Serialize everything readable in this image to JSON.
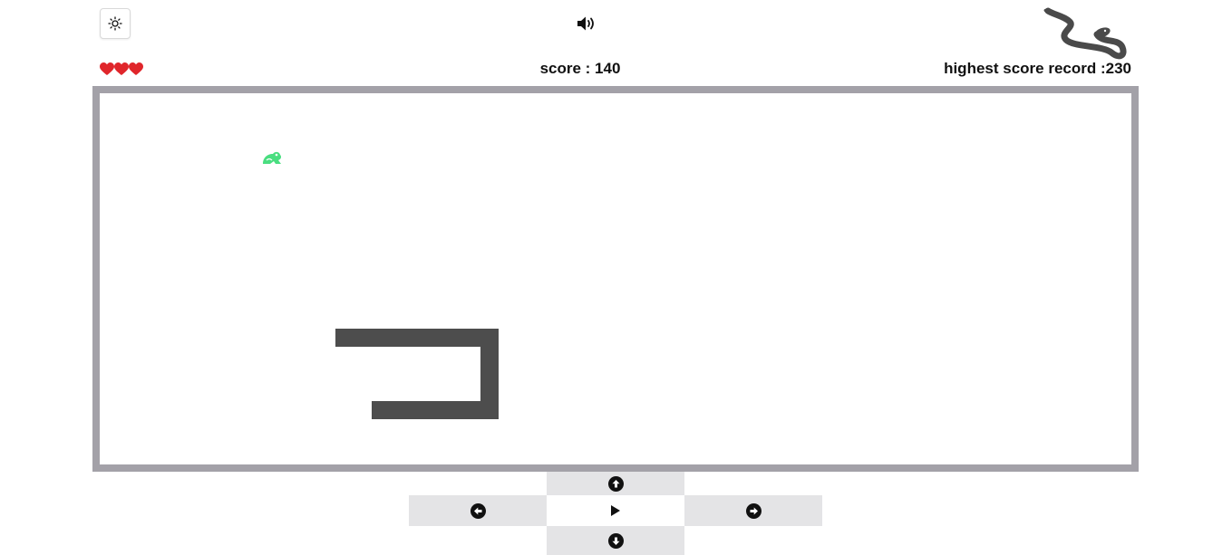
{
  "header": {
    "theme_toggle_icon": "sun-icon",
    "sound_icon": "volume-icon",
    "logo_icon": "snake-logo"
  },
  "status": {
    "lives": 3,
    "score_text": "score : 140",
    "highscore_text": "highest score record :230"
  },
  "game": {
    "snake_color": "#4d4d4d",
    "food_color": "#4ade80",
    "food_icon": "frog-icon",
    "border_color": "#a3a1a8"
  },
  "controls": {
    "up_icon": "arrow-up-circle-icon",
    "left_icon": "arrow-left-circle-icon",
    "play_icon": "play-icon",
    "right_icon": "arrow-right-circle-icon",
    "down_icon": "arrow-down-circle-icon",
    "button_color": "#e4e4e6"
  }
}
